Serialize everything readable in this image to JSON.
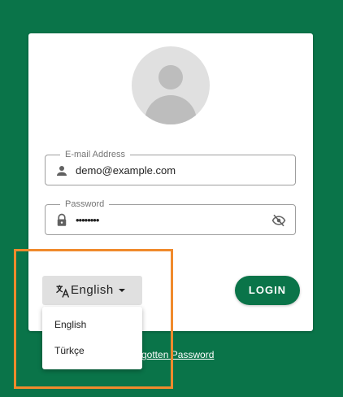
{
  "login_form": {
    "email": {
      "label": "E-mail Address",
      "value": "demo@example.com",
      "icon": "person-icon"
    },
    "password": {
      "label": "Password",
      "value": "••••••••",
      "icon": "lock-icon",
      "toggle_icon": "eye-off-icon"
    },
    "language_button": {
      "label": "English",
      "icon": "translate-icon"
    },
    "login_button": "LOGIN",
    "forgot_password_link": "gotten Password"
  },
  "language_menu": {
    "options": [
      "English",
      "Türkçe"
    ]
  },
  "colors": {
    "brand_green": "#0a7449",
    "highlight_orange": "#f08a2c"
  }
}
